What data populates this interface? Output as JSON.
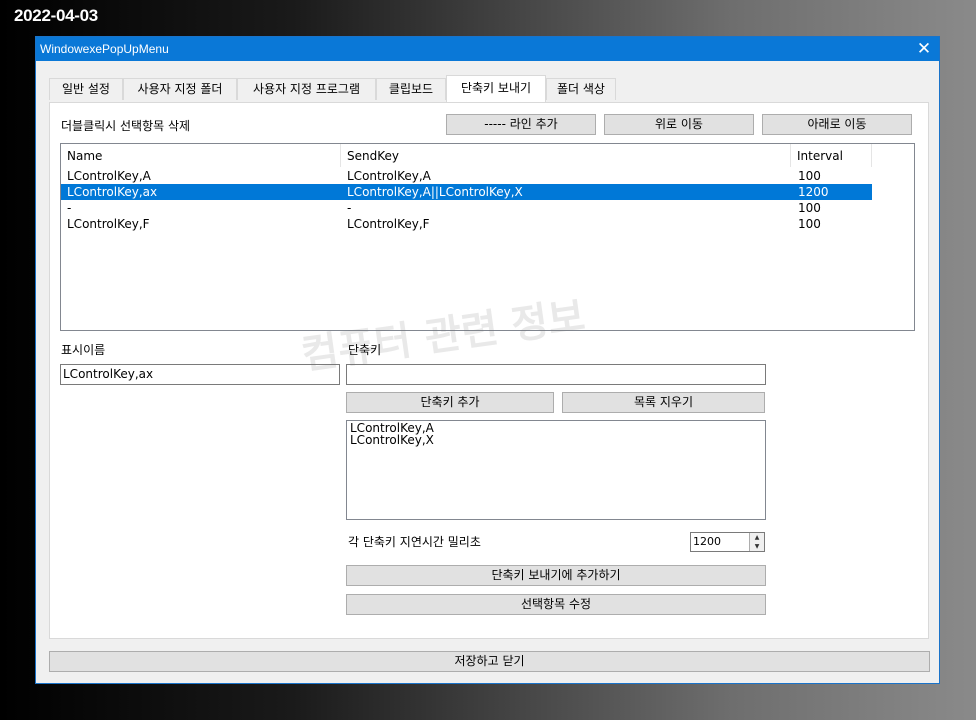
{
  "date_stamp": "2022-04-03",
  "window": {
    "title": "WindowexePopUpMenu"
  },
  "tabs": [
    {
      "label": "일반 설정"
    },
    {
      "label": "사용자 지정 폴더"
    },
    {
      "label": "사용자 지정 프로그램"
    },
    {
      "label": "클립보드"
    },
    {
      "label": "단축키 보내기",
      "active": true
    },
    {
      "label": "폴더 색상"
    }
  ],
  "panel": {
    "delete_hint": "더블클릭시 선택항목 삭제",
    "add_line_button": "----- 라인 추가",
    "move_up_button": "위로 이동",
    "move_down_button": "아래로 이동",
    "list": {
      "columns": [
        "Name",
        "SendKey",
        "Interval"
      ],
      "rows": [
        {
          "name": "LControlKey,A",
          "sendkey": "LControlKey,A",
          "interval": "100"
        },
        {
          "name": "LControlKey,ax",
          "sendkey": "LControlKey,A||LControlKey,X",
          "interval": "1200",
          "selected": true
        },
        {
          "name": "-",
          "sendkey": "-",
          "interval": "100"
        },
        {
          "name": "LControlKey,F",
          "sendkey": "LControlKey,F",
          "interval": "100"
        }
      ]
    },
    "display_name_label": "표시이름",
    "display_name_value": "LControlKey,ax",
    "shortcut_label": "단축키",
    "shortcut_value": "",
    "add_shortcut_button": "단축키 추가",
    "clear_list_button": "목록 지우기",
    "shortcut_list": [
      "LControlKey,A",
      "LControlKey,X"
    ],
    "delay_label": "각 단축키 지연시간 밀리초",
    "delay_value": "1200",
    "add_to_sender_button": "단축키 보내기에 추가하기",
    "modify_selected_button": "선택항목 수정"
  },
  "save_close_button": "저장하고 닫기",
  "watermark": "컴퓨터 관련 정보"
}
